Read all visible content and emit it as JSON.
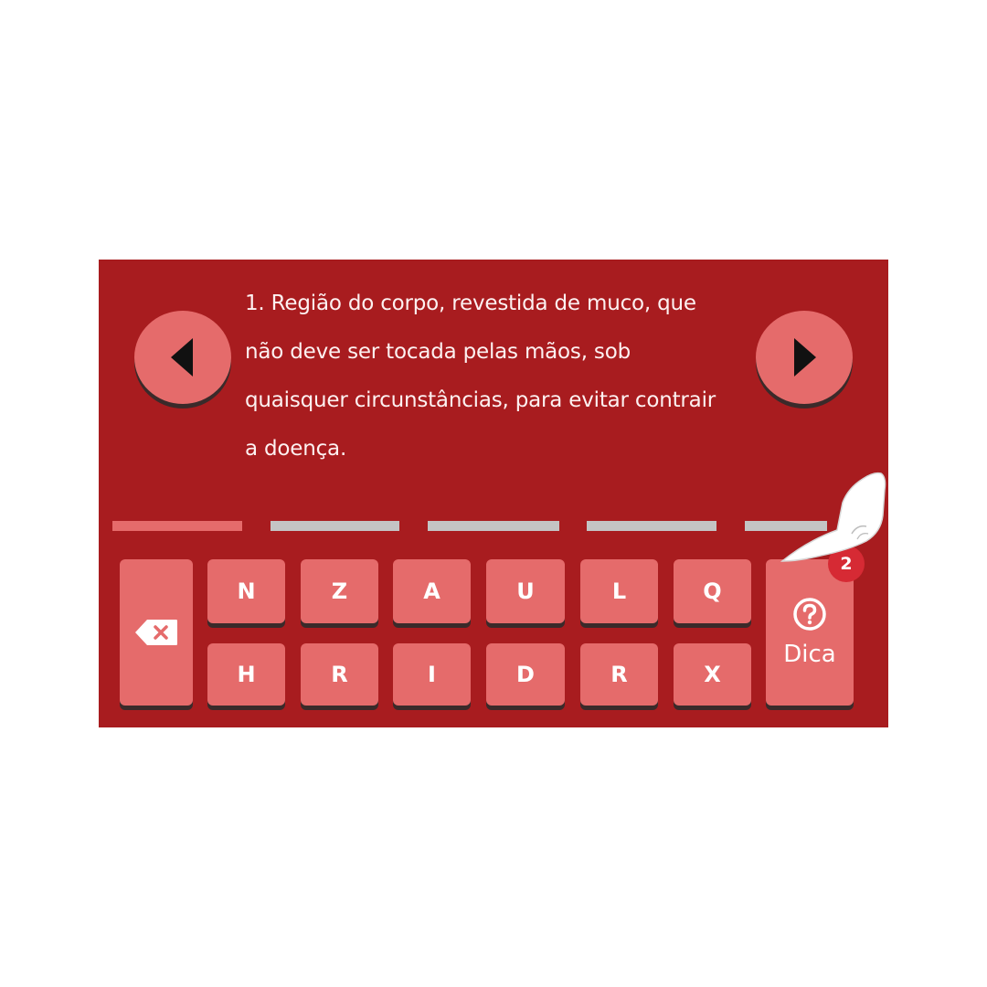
{
  "clue": {
    "lines": [
      "1. Região do corpo, revestida de muco, que",
      "não deve ser tocada pelas mãos, sob",
      "quaisquer circunstâncias, para evitar contrair",
      "a doença."
    ]
  },
  "nav": {
    "prev_icon": "triangle-left-icon",
    "next_icon": "triangle-right-icon"
  },
  "answer": {
    "slot_count": 5,
    "active_slot_index": 0
  },
  "keyboard": {
    "row1": [
      "N",
      "Z",
      "A",
      "U",
      "L",
      "Q"
    ],
    "row2": [
      "H",
      "R",
      "I",
      "D",
      "R",
      "X"
    ],
    "delete_icon": "backspace-icon"
  },
  "hint": {
    "label": "Dica",
    "icon": "question-circle-icon",
    "count": "2"
  },
  "colors": {
    "background": "#a81c1f",
    "key": "#e56b6b",
    "slot_active": "#e56b6b",
    "slot_inactive": "#c4c4c4",
    "badge": "#d62a34",
    "text": "#ffffff"
  }
}
